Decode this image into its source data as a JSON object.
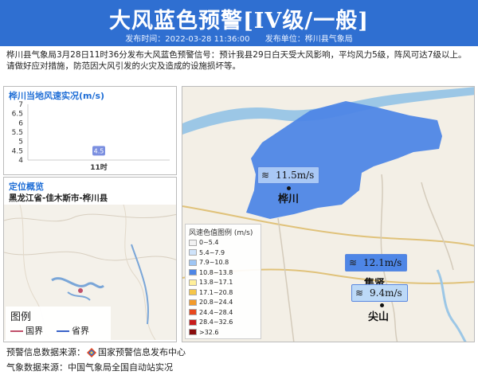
{
  "header": {
    "title": "大风蓝色预警[IV级/一般]",
    "publish_time": "发布时间：2022-03-28 11:36:00",
    "publish_unit": "发布单位：桦川县气象局"
  },
  "description": "桦川县气象局3月28日11时36分发布大风蓝色预警信号：预计我县29日白天受大风影响，平均风力5级，阵风可达7级以上。请做好应对措施，防范因大风引发的火灾及造成的设施损坏等。",
  "wind_panel": {
    "title": "桦川当地风速实况(m/s)"
  },
  "chart_data": {
    "type": "bar",
    "categories": [
      "11时"
    ],
    "values": [
      4.5
    ],
    "data_labels": [
      "4.5"
    ],
    "yticks": [
      "7",
      "6.5",
      "6",
      "5.5",
      "5",
      "4.5",
      "4"
    ],
    "ylim": [
      4,
      7
    ],
    "title": "桦川当地风速实况(m/s)",
    "bar_color": "#7b8fe0"
  },
  "location_panel": {
    "title": "定位概览",
    "path": "黑龙江省-佳木斯市-桦川县",
    "legend_title": "图例",
    "legend_items": [
      {
        "label": "国界",
        "color": "#c0506a"
      },
      {
        "label": "省界",
        "color": "#3a63c8"
      }
    ]
  },
  "map": {
    "stations": [
      {
        "name": "桦川",
        "wind": "11.5m/s"
      },
      {
        "name": "集贤",
        "wind": "12.1m/s"
      },
      {
        "name": "尖山",
        "wind": "9.4m/s"
      }
    ],
    "legend": {
      "title": "风速色值图例 (m/s)",
      "items": [
        {
          "label": "0~5.4",
          "color": "#f2f2f2"
        },
        {
          "label": "5.4~7.9",
          "color": "#cfe3fa"
        },
        {
          "label": "7.9~10.8",
          "color": "#9fc6f4"
        },
        {
          "label": "10.8~13.8",
          "color": "#4e86e6"
        },
        {
          "label": "13.8~17.1",
          "color": "#ffef9a"
        },
        {
          "label": "17.1~20.8",
          "color": "#f6c64a"
        },
        {
          "label": "20.8~24.4",
          "color": "#f39a2a"
        },
        {
          "label": "24.4~28.4",
          "color": "#e8481e"
        },
        {
          "label": "28.4~32.6",
          "color": "#c81c1c"
        },
        {
          "label": ">32.6",
          "color": "#8a0d0d"
        }
      ]
    }
  },
  "footer": {
    "warning_source_label": "预警信息数据来源：",
    "warning_source": "国家预警信息发布中心",
    "weather_source": "气象数据来源：中国气象局全国自动站实况"
  },
  "colors": {
    "header_bg": "#2f6fd1",
    "accent": "#1f6ed6",
    "warning_area": "#4e86e6"
  }
}
